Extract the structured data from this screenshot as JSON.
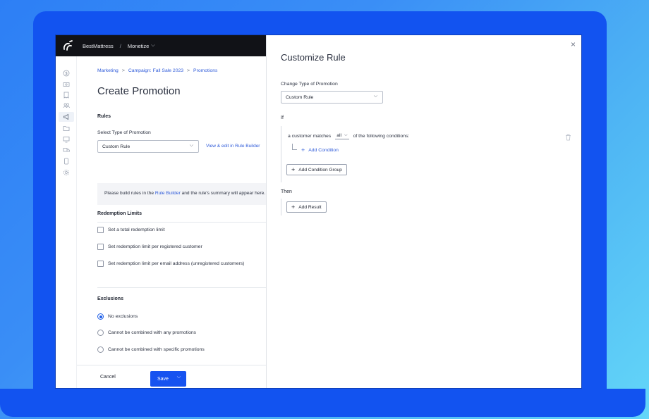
{
  "topbar": {
    "brand": "BestMattress",
    "separator": "/",
    "app": "Monetize",
    "app_chevron": "⌵"
  },
  "main": {
    "breadcrumb": {
      "items": [
        "Marketing",
        "Campaign: Fall Sale 2023",
        "Promotions"
      ],
      "separator": ">"
    },
    "title": "Create Promotion",
    "rules": {
      "heading": "Rules",
      "select_label": "Select Type of Promotion",
      "select_value": "Custom Rule",
      "edit_link": "View & edit in Rule Builder",
      "info_prefix": "Please build rules in the ",
      "info_link": "Rule Builder",
      "info_suffix": " and the rule's summary will appear here."
    },
    "redemption": {
      "heading": "Redemption Limits",
      "options": [
        "Set a total redemption limit",
        "Set redemption limit per registered customer",
        "Set redemption limit per email address (unregistered customers)"
      ]
    },
    "exclusions": {
      "heading": "Exclusions",
      "options": [
        "No exclusions",
        "Cannot be combined with any promotions",
        "Cannot be combined with specific promotions"
      ],
      "selected_index": 0
    },
    "footer": {
      "cancel": "Cancel",
      "save": "Save",
      "save_chevron": "⌵"
    }
  },
  "panel": {
    "title": "Customize Rule",
    "close": "×",
    "type_label": "Change Type of Promotion",
    "type_value": "Custom Rule",
    "if_label": "If",
    "condition_prefix": "a customer matches",
    "match_value": "all",
    "condition_suffix": "of the following conditions:",
    "add_condition": "Add Condition",
    "add_condition_group": "Add Condition Group",
    "then_label": "Then",
    "add_result": "Add Result"
  },
  "colors": {
    "accent": "#1753f0",
    "link": "#2f5bd9",
    "topbar": "#111217",
    "background": "#3a8ef6"
  }
}
